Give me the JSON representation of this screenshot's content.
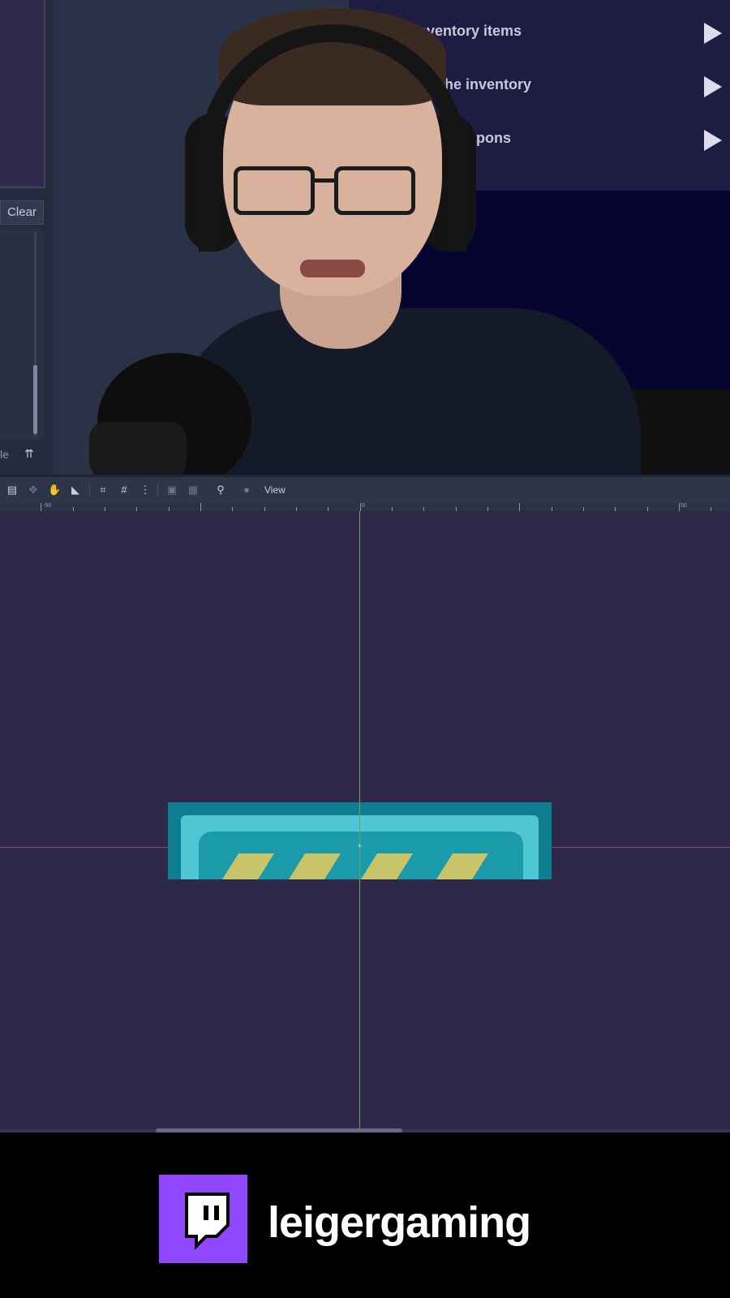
{
  "left_dock": {
    "clear_button": "Clear",
    "bottom_label": "le",
    "collapse_icon": "double-chevron-up-icon"
  },
  "episode_list": {
    "items": [
      {
        "label": "Inventory items",
        "icon": "play-icon"
      },
      {
        "label": "ing the inventory",
        "icon": "play-icon"
      },
      {
        "label": "ping weapons",
        "icon": "play-icon"
      }
    ]
  },
  "toolbar": {
    "icons": [
      "select-icon",
      "move-icon",
      "pan-icon",
      "ruler-icon",
      "snap-icon",
      "grid-icon",
      "more-icon",
      "lock-icon",
      "group-icon",
      "bone-icon",
      "skeleton-icon"
    ],
    "view_menu": "View"
  },
  "ruler": {
    "labels": [
      "-50",
      "0",
      "50"
    ]
  },
  "footer": {
    "platform_icon": "twitch-icon",
    "username": "leigergaming",
    "brand_color": "#9146ff"
  },
  "colors": {
    "viewport_bg": "#2e2948",
    "y_axis": "#6aa15a",
    "x_axis": "#8b3a86"
  }
}
